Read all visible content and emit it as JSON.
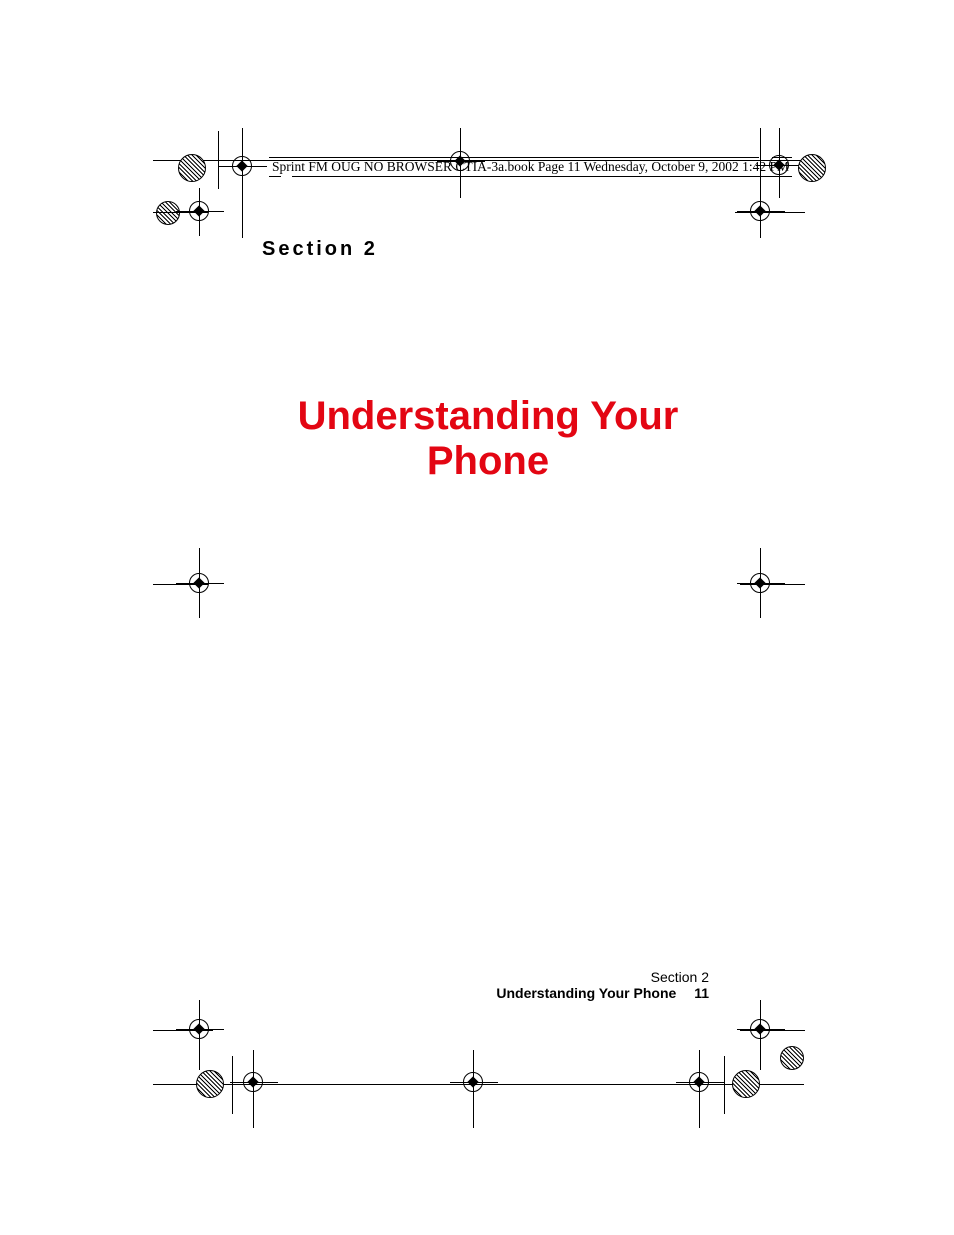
{
  "running_head": "Sprint FM OUG NO BROWSER CTIA-3a.book  Page 11  Wednesday, October 9, 2002  1:42 PM",
  "section_label": "Section 2",
  "chapter_title": "Understanding Your Phone",
  "footer": {
    "section": "Section 2",
    "title": "Understanding Your Phone",
    "page_number": "11"
  }
}
